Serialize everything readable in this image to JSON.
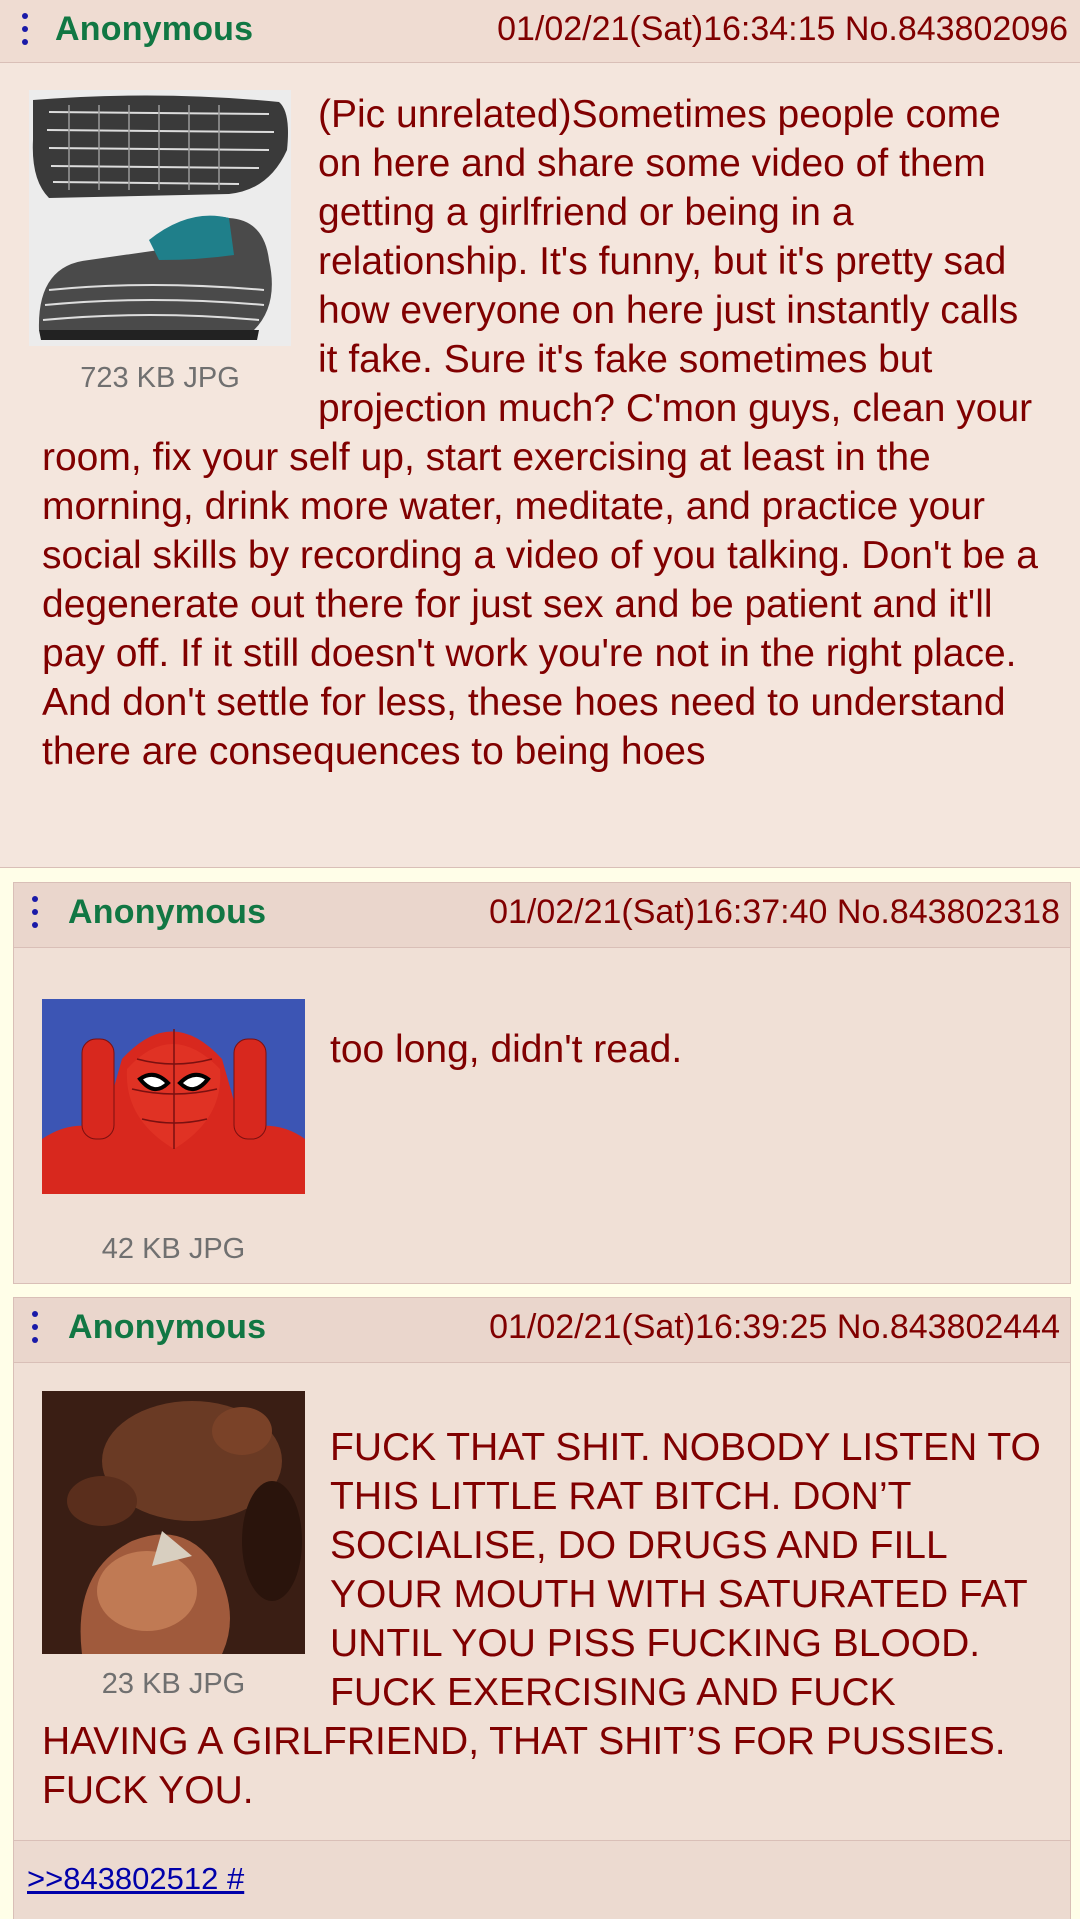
{
  "posts": [
    {
      "name": "Anonymous",
      "datetime": "01/02/21(Sat)16:34:15",
      "number": "No.843802096",
      "file_info": "723 KB JPG",
      "thumb_icon": "sneaker-image",
      "comment": "(Pic unrelated)Sometimes people come on here and share some video of them getting a girlfriend or being in a relationship. It's funny, but it's pretty sad how everyone on here just instantly calls it fake. Sure it's fake sometimes but projection much? C'mon guys, clean your room, fix your self up, start exercising at least in the morning, drink more water, meditate, and practice your social skills by recording a video of you talking. Don't be a degenerate out there for just sex and be patient and it'll pay off. If it still doesn't work you're not in the right place. And don't settle for less, these hoes need to understand there are consequences to being hoes"
    },
    {
      "name": "Anonymous",
      "datetime": "01/02/21(Sat)16:37:40",
      "number": "No.843802318",
      "file_info": "42 KB JPG",
      "thumb_icon": "spiderman-image",
      "comment": "too long, didn't read."
    },
    {
      "name": "Anonymous",
      "datetime": "01/02/21(Sat)16:39:25",
      "number": "No.843802444",
      "file_info": "23 KB JPG",
      "thumb_icon": "painting-image",
      "comment": "FUCK THAT SHIT. NOBODY LISTEN TO THIS LITTLE RAT BITCH. DON’T SOCIALISE, DO DRUGS AND FILL YOUR MOUTH WITH SATURATED FAT UNTIL YOU PISS FUCKING BLOOD. FUCK EXERCISING AND FUCK HAVING A GIRLFRIEND, THAT SHIT’S FOR PUSSIES. FUCK YOU.",
      "backlink": ">>843802512 #"
    }
  ],
  "colors": {
    "name": "#117743",
    "text": "#800000",
    "post_bg": "#f0e0d6",
    "page_bg": "#fffee8",
    "link": "#0000aa"
  }
}
